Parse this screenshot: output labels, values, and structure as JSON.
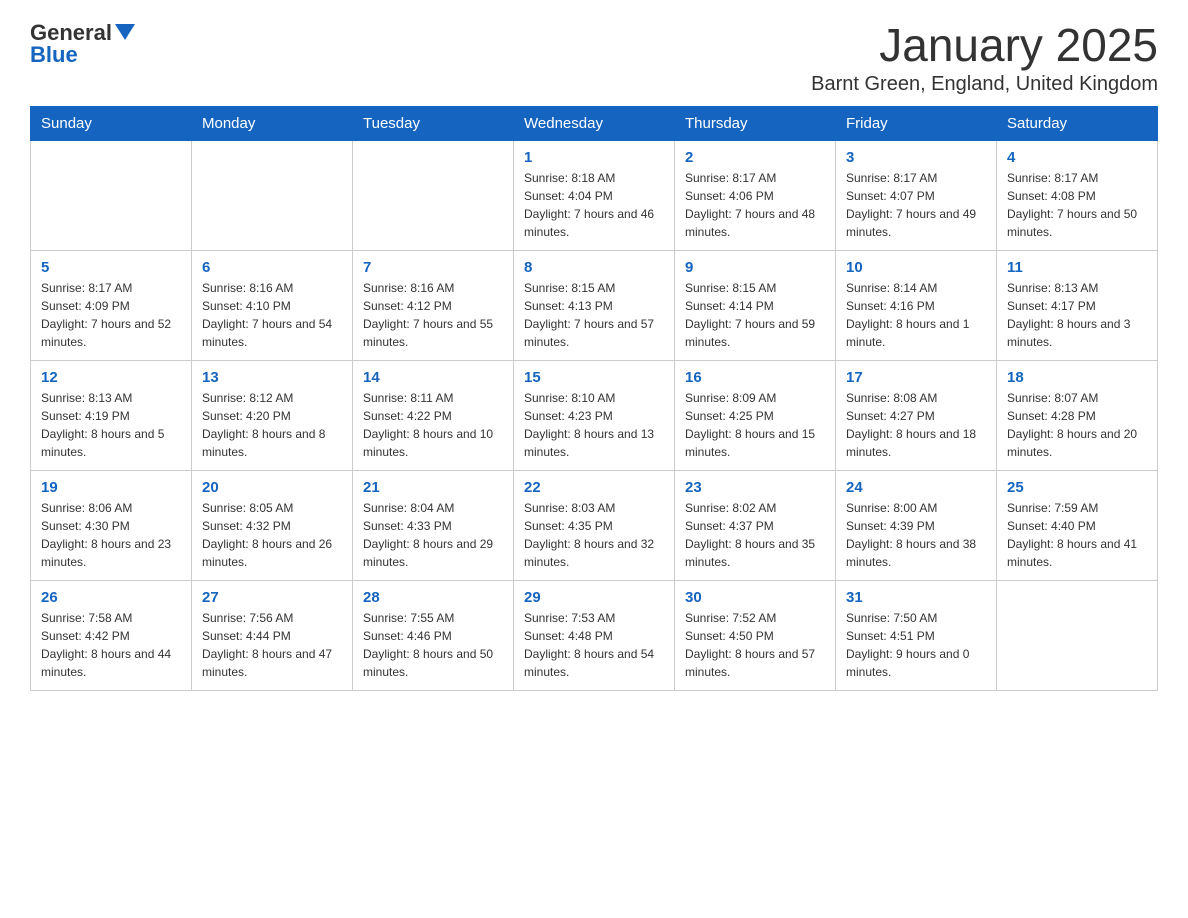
{
  "logo": {
    "text_general": "General",
    "text_blue": "Blue"
  },
  "title": "January 2025",
  "location": "Barnt Green, England, United Kingdom",
  "days_of_week": [
    "Sunday",
    "Monday",
    "Tuesday",
    "Wednesday",
    "Thursday",
    "Friday",
    "Saturday"
  ],
  "weeks": [
    [
      {
        "day": "",
        "sunrise": "",
        "sunset": "",
        "daylight": ""
      },
      {
        "day": "",
        "sunrise": "",
        "sunset": "",
        "daylight": ""
      },
      {
        "day": "",
        "sunrise": "",
        "sunset": "",
        "daylight": ""
      },
      {
        "day": "1",
        "sunrise": "Sunrise: 8:18 AM",
        "sunset": "Sunset: 4:04 PM",
        "daylight": "Daylight: 7 hours and 46 minutes."
      },
      {
        "day": "2",
        "sunrise": "Sunrise: 8:17 AM",
        "sunset": "Sunset: 4:06 PM",
        "daylight": "Daylight: 7 hours and 48 minutes."
      },
      {
        "day": "3",
        "sunrise": "Sunrise: 8:17 AM",
        "sunset": "Sunset: 4:07 PM",
        "daylight": "Daylight: 7 hours and 49 minutes."
      },
      {
        "day": "4",
        "sunrise": "Sunrise: 8:17 AM",
        "sunset": "Sunset: 4:08 PM",
        "daylight": "Daylight: 7 hours and 50 minutes."
      }
    ],
    [
      {
        "day": "5",
        "sunrise": "Sunrise: 8:17 AM",
        "sunset": "Sunset: 4:09 PM",
        "daylight": "Daylight: 7 hours and 52 minutes."
      },
      {
        "day": "6",
        "sunrise": "Sunrise: 8:16 AM",
        "sunset": "Sunset: 4:10 PM",
        "daylight": "Daylight: 7 hours and 54 minutes."
      },
      {
        "day": "7",
        "sunrise": "Sunrise: 8:16 AM",
        "sunset": "Sunset: 4:12 PM",
        "daylight": "Daylight: 7 hours and 55 minutes."
      },
      {
        "day": "8",
        "sunrise": "Sunrise: 8:15 AM",
        "sunset": "Sunset: 4:13 PM",
        "daylight": "Daylight: 7 hours and 57 minutes."
      },
      {
        "day": "9",
        "sunrise": "Sunrise: 8:15 AM",
        "sunset": "Sunset: 4:14 PM",
        "daylight": "Daylight: 7 hours and 59 minutes."
      },
      {
        "day": "10",
        "sunrise": "Sunrise: 8:14 AM",
        "sunset": "Sunset: 4:16 PM",
        "daylight": "Daylight: 8 hours and 1 minute."
      },
      {
        "day": "11",
        "sunrise": "Sunrise: 8:13 AM",
        "sunset": "Sunset: 4:17 PM",
        "daylight": "Daylight: 8 hours and 3 minutes."
      }
    ],
    [
      {
        "day": "12",
        "sunrise": "Sunrise: 8:13 AM",
        "sunset": "Sunset: 4:19 PM",
        "daylight": "Daylight: 8 hours and 5 minutes."
      },
      {
        "day": "13",
        "sunrise": "Sunrise: 8:12 AM",
        "sunset": "Sunset: 4:20 PM",
        "daylight": "Daylight: 8 hours and 8 minutes."
      },
      {
        "day": "14",
        "sunrise": "Sunrise: 8:11 AM",
        "sunset": "Sunset: 4:22 PM",
        "daylight": "Daylight: 8 hours and 10 minutes."
      },
      {
        "day": "15",
        "sunrise": "Sunrise: 8:10 AM",
        "sunset": "Sunset: 4:23 PM",
        "daylight": "Daylight: 8 hours and 13 minutes."
      },
      {
        "day": "16",
        "sunrise": "Sunrise: 8:09 AM",
        "sunset": "Sunset: 4:25 PM",
        "daylight": "Daylight: 8 hours and 15 minutes."
      },
      {
        "day": "17",
        "sunrise": "Sunrise: 8:08 AM",
        "sunset": "Sunset: 4:27 PM",
        "daylight": "Daylight: 8 hours and 18 minutes."
      },
      {
        "day": "18",
        "sunrise": "Sunrise: 8:07 AM",
        "sunset": "Sunset: 4:28 PM",
        "daylight": "Daylight: 8 hours and 20 minutes."
      }
    ],
    [
      {
        "day": "19",
        "sunrise": "Sunrise: 8:06 AM",
        "sunset": "Sunset: 4:30 PM",
        "daylight": "Daylight: 8 hours and 23 minutes."
      },
      {
        "day": "20",
        "sunrise": "Sunrise: 8:05 AM",
        "sunset": "Sunset: 4:32 PM",
        "daylight": "Daylight: 8 hours and 26 minutes."
      },
      {
        "day": "21",
        "sunrise": "Sunrise: 8:04 AM",
        "sunset": "Sunset: 4:33 PM",
        "daylight": "Daylight: 8 hours and 29 minutes."
      },
      {
        "day": "22",
        "sunrise": "Sunrise: 8:03 AM",
        "sunset": "Sunset: 4:35 PM",
        "daylight": "Daylight: 8 hours and 32 minutes."
      },
      {
        "day": "23",
        "sunrise": "Sunrise: 8:02 AM",
        "sunset": "Sunset: 4:37 PM",
        "daylight": "Daylight: 8 hours and 35 minutes."
      },
      {
        "day": "24",
        "sunrise": "Sunrise: 8:00 AM",
        "sunset": "Sunset: 4:39 PM",
        "daylight": "Daylight: 8 hours and 38 minutes."
      },
      {
        "day": "25",
        "sunrise": "Sunrise: 7:59 AM",
        "sunset": "Sunset: 4:40 PM",
        "daylight": "Daylight: 8 hours and 41 minutes."
      }
    ],
    [
      {
        "day": "26",
        "sunrise": "Sunrise: 7:58 AM",
        "sunset": "Sunset: 4:42 PM",
        "daylight": "Daylight: 8 hours and 44 minutes."
      },
      {
        "day": "27",
        "sunrise": "Sunrise: 7:56 AM",
        "sunset": "Sunset: 4:44 PM",
        "daylight": "Daylight: 8 hours and 47 minutes."
      },
      {
        "day": "28",
        "sunrise": "Sunrise: 7:55 AM",
        "sunset": "Sunset: 4:46 PM",
        "daylight": "Daylight: 8 hours and 50 minutes."
      },
      {
        "day": "29",
        "sunrise": "Sunrise: 7:53 AM",
        "sunset": "Sunset: 4:48 PM",
        "daylight": "Daylight: 8 hours and 54 minutes."
      },
      {
        "day": "30",
        "sunrise": "Sunrise: 7:52 AM",
        "sunset": "Sunset: 4:50 PM",
        "daylight": "Daylight: 8 hours and 57 minutes."
      },
      {
        "day": "31",
        "sunrise": "Sunrise: 7:50 AM",
        "sunset": "Sunset: 4:51 PM",
        "daylight": "Daylight: 9 hours and 0 minutes."
      },
      {
        "day": "",
        "sunrise": "",
        "sunset": "",
        "daylight": ""
      }
    ]
  ]
}
